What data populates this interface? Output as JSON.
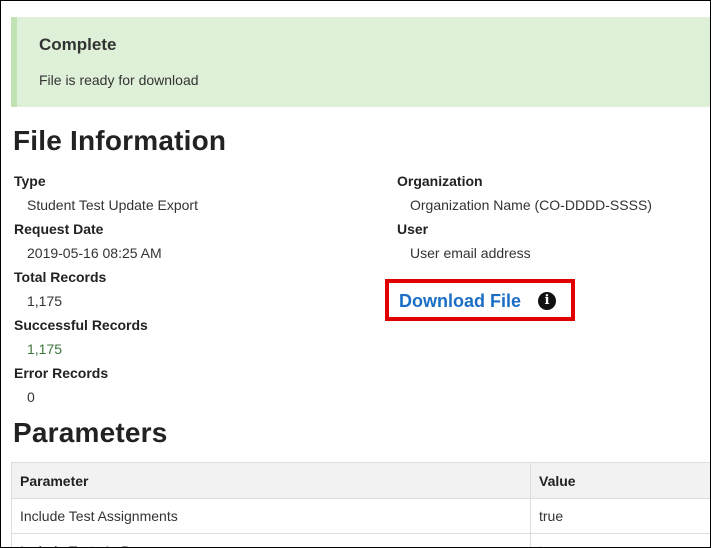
{
  "alert": {
    "title": "Complete",
    "message": "File is ready for download"
  },
  "file_info": {
    "heading": "File Information",
    "type_label": "Type",
    "type_value": "Student Test Update Export",
    "request_date_label": "Request Date",
    "request_date_value": "2019-05-16 08:25 AM",
    "total_records_label": "Total Records",
    "total_records_value": "1,175",
    "successful_records_label": "Successful Records",
    "successful_records_value": "1,175",
    "error_records_label": "Error Records",
    "error_records_value": "0",
    "organization_label": "Organization",
    "organization_value": "Organization Name (CO-DDDD-SSSS)",
    "user_label": "User",
    "user_value": "User email address",
    "download_label": "Download File"
  },
  "parameters": {
    "heading": "Parameters",
    "columns": [
      "Parameter",
      "Value"
    ],
    "rows": [
      [
        "Include Test Assignments",
        "true"
      ],
      [
        "Include Tests In Progress",
        "true"
      ]
    ]
  },
  "colors": {
    "alert_bg": "#dff0d8",
    "link": "#1a6fc4",
    "highlight_box": "#e00000",
    "success_text": "#3c763d"
  },
  "icons": {
    "info": "info-circle-icon"
  }
}
